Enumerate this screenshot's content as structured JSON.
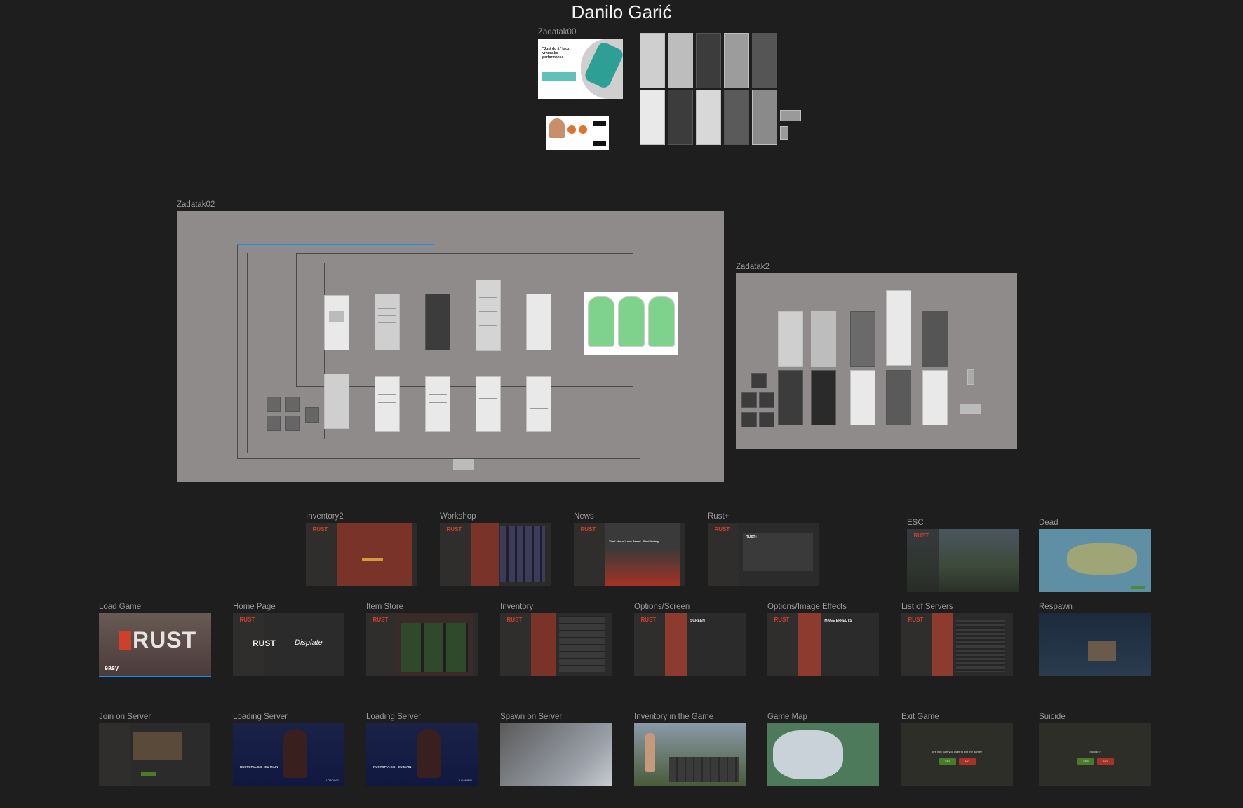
{
  "canvas": {
    "title": "Danilo Garić",
    "background": "#1e1e1e"
  },
  "frames": {
    "zadatak00": "Zadatak00",
    "zadatak02": "Zadatak02",
    "zadatak2": "Zadatak2",
    "inventory2": "Inventory2",
    "workshop": "Workshop",
    "news": "News",
    "rust_plus": "Rust+",
    "esc": "ESC",
    "dead": "Dead",
    "load_game": "Load Game",
    "home_page": "Home Page",
    "item_store": "Item Store",
    "inventory": "Inventory",
    "options_screen": "Options/Screen",
    "options_image_effects": "Options/Image Effects",
    "list_of_servers": "List of Servers",
    "respawn": "Respawn",
    "join_on_server": "Join on Server",
    "loading_server_1": "Loading Server",
    "loading_server_2": "Loading Server",
    "spawn_on_server": "Spawn on Server",
    "inventory_in_game": "Inventory in the Game",
    "game_map": "Game Map",
    "exit_game": "Exit Game",
    "suicide": "Suicide"
  },
  "thumbnails": {
    "rust_logo": "RUST",
    "rust_brand": "RUST",
    "easy_logo": "easy",
    "displate": "Displate",
    "screen_heading": "SCREEN",
    "image_effects_heading": "IMAGE EFFECTS",
    "news_headline": "The Lake of Lone Jamet - Find Voting",
    "rust_plus_label": "RUST+",
    "loading_server_text": "RUSTOPIA.GG - EU MAIN",
    "loading_label": "LOADING",
    "exit_question": "Are you sure you want to exit the game?",
    "suicide_question": "Suicide?",
    "yes": "YES",
    "no": "NO",
    "nike_slogan": "\"Just do it\" kroz vrhunske performanse",
    "waiting_text": "WAITING FOR GAME"
  },
  "colors": {
    "rust_red": "#cd412b",
    "canvas_gray": "#8f8b8a",
    "selection_blue": "#1d8cf2",
    "phone_green": "#7fd28b"
  }
}
